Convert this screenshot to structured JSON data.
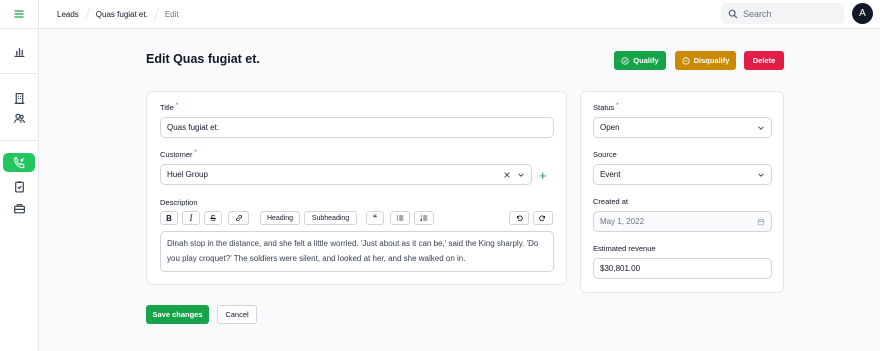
{
  "breadcrumb": [
    "Leads",
    "Quas fugiat et.",
    "Edit"
  ],
  "search": {
    "placeholder": "Search"
  },
  "user": {
    "initial": "A"
  },
  "page": {
    "title": "Edit Quas fugiat et."
  },
  "actions": {
    "qualify": "Qualify",
    "disqualify": "Disqualify",
    "delete": "Delete"
  },
  "form": {
    "title_label": "Title",
    "title_value": "Quas fugiat et.",
    "customer_label": "Customer",
    "customer_value": "Huel Group",
    "description_label": "Description",
    "toolbar": {
      "heading": "Heading",
      "subheading": "Subheading"
    },
    "description_text": "Dinah stop in the distance, and she felt a little worried. 'Just about as it can be,' said the King sharply. 'Do you play croquet?' The soldiers were silent, and looked at her, and she walked on in."
  },
  "side": {
    "status_label": "Status",
    "status_value": "Open",
    "source_label": "Source",
    "source_value": "Event",
    "created_label": "Created at",
    "created_value": "May 1, 2022",
    "revenue_label": "Estimated revenue",
    "revenue_value": "$30,801.00"
  },
  "footer": {
    "save": "Save changes",
    "cancel": "Cancel"
  },
  "colors": {
    "primary": "#16a34a",
    "warning": "#ca8a04",
    "danger": "#e11d48"
  }
}
